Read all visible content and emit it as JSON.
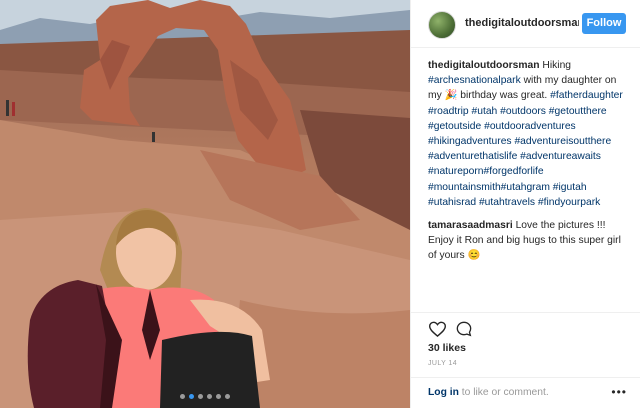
{
  "header": {
    "username": "thedigitaloutdoorsmar",
    "follow_label": "Follow"
  },
  "caption": {
    "username": "thedigitaloutdoorsman",
    "text_1": " Hiking ",
    "tag_1": "#archesnationalpark",
    "text_2": " with my daughter on my 🎉 birthday was great. ",
    "tags": "#fatherdaughter #roadtrip #utah #outdoors #getoutthere #getoutside #outdooradventures #hikingadventures #adventureisoutthere #adventurethatislife #adventureawaits #natureporn#forgedforlife #mountainsmith#utahgram #igutah #utahisrad #utahtravels #findyourpark"
  },
  "comment": {
    "username": "tamarasaadmasri",
    "text": " Love the pictures !!! Enjoy it Ron and big hugs to this super girl of yours 😊"
  },
  "actions": {
    "like_icon": "heart-icon",
    "comment_icon": "comment-bubble-icon",
    "likes_text": "30 likes",
    "date_text": "JULY 14"
  },
  "footer": {
    "login_link": "Log in",
    "login_text": " to like or comment.",
    "more_label": "•••"
  },
  "carousel": {
    "count": 6,
    "active_index": 1
  },
  "colors": {
    "accent": "#3897f0",
    "hashtag": "#003569"
  }
}
